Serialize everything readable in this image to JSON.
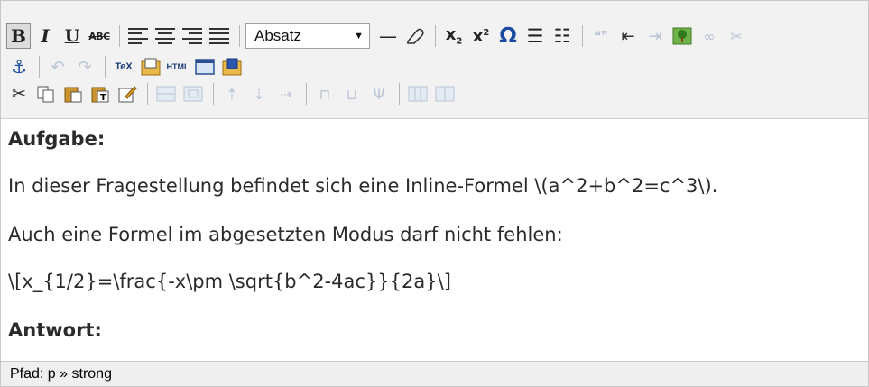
{
  "toolbar": {
    "block_format": {
      "selected": "Absatz"
    },
    "html_label": "HTML",
    "tex_label": "TeX",
    "row1": [
      "bold-icon",
      "italic-icon",
      "underline-icon",
      "strikethrough-icon",
      "align-left-icon",
      "align-center-icon",
      "align-right-icon",
      "justify-icon",
      "horizontal-rule-icon",
      "eraser-icon",
      "subscript-icon",
      "superscript-icon",
      "omega-icon",
      "bullet-list-icon",
      "numbered-list-icon",
      "quote-icon",
      "outdent-icon",
      "indent-icon",
      "image-icon",
      "link-icon",
      "unlink-icon"
    ],
    "row2": [
      "anchor-icon",
      "undo-icon",
      "redo-icon",
      "tex-icon",
      "insert-file-icon",
      "html-source-icon",
      "window-icon",
      "insert-word-icon"
    ],
    "row3": [
      "cut-icon",
      "copy-icon",
      "paste-icon",
      "paste-text-icon",
      "edit-icon",
      "table-icon",
      "table-props-icon",
      "row-insert-above-icon",
      "row-insert-below-icon",
      "row-delete-icon",
      "col-insert-icon",
      "col-delete-icon",
      "col-split-icon",
      "merge-cells-icon",
      "split-cells-icon"
    ]
  },
  "content": {
    "heading_task": "Aufgabe:",
    "para_inline": "In dieser Fragestellung befindet sich eine Inline-Formel \\(a^2+b^2=c^3\\).",
    "para_display_intro": "Auch eine Formel im abgesetzten Modus darf nicht fehlen:",
    "formula": "\\[x_{1/2}=\\frac{-x\\pm \\sqrt{b^2-4ac}}{2a}\\]",
    "heading_answer": "Antwort:"
  },
  "statusbar": {
    "path": "Pfad: p » strong"
  }
}
